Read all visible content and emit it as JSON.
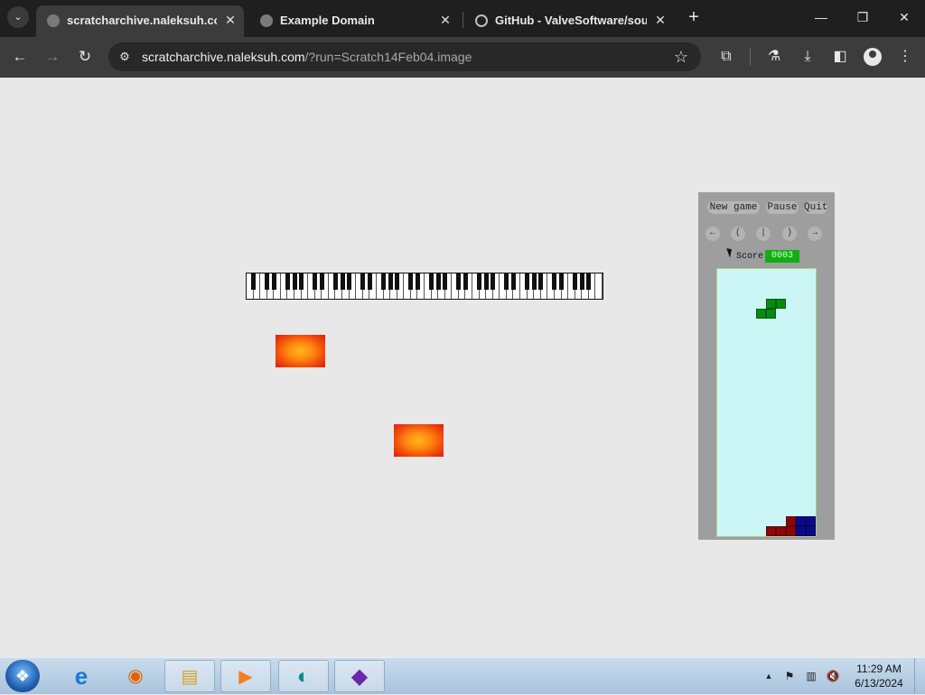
{
  "browser": {
    "tabs": [
      {
        "title": "scratcharchive.naleksuh.com/?",
        "active": true
      },
      {
        "title": "Example Domain",
        "active": false
      },
      {
        "title": "GitHub - ValveSoftware/sourc",
        "active": false
      }
    ],
    "new_tab_symbol": "+",
    "window_buttons": {
      "minimize": "—",
      "restore": "❐",
      "close": "✕"
    },
    "nav": {
      "back": "←",
      "forward": "→",
      "reload": "↻"
    },
    "url_host": "scratcharchive.naleksuh.com",
    "url_path": "/?run=Scratch14Feb04.image",
    "icons": {
      "star": "☆",
      "extensions": "⧉",
      "labs": "⚗",
      "download": "⤓",
      "sidepanel": "◧",
      "menu": "⋮",
      "tab_close": "✕",
      "tab_list": "⌄",
      "site_info": "⚙"
    }
  },
  "page": {
    "tetris": {
      "buttons": [
        "New game",
        "Pause",
        "Quit"
      ],
      "controls": [
        "←",
        "(",
        "|",
        ")",
        "→"
      ],
      "score_label": "Score:",
      "score_value": "0003"
    }
  },
  "taskbar": {
    "start_glyph": "❖",
    "items": [
      {
        "name": "internet-explorer",
        "glyph": "e",
        "color": "#1a78d0"
      },
      {
        "name": "firefox",
        "glyph": "◉",
        "color": "#e66000"
      },
      {
        "name": "file-explorer",
        "glyph": "▤",
        "color": "#d8a020"
      },
      {
        "name": "media-player",
        "glyph": "▶",
        "color": "#f08020"
      },
      {
        "name": "browser",
        "glyph": "◐",
        "color": "#0e8a8a"
      },
      {
        "name": "visual-studio",
        "glyph": "◆",
        "color": "#6a2aa8"
      }
    ],
    "tray_icons": {
      "show_hidden": "▲",
      "flag": "⚑",
      "network": "▥",
      "volume": "🔇"
    },
    "time": "11:29 AM",
    "date": "6/13/2024"
  }
}
